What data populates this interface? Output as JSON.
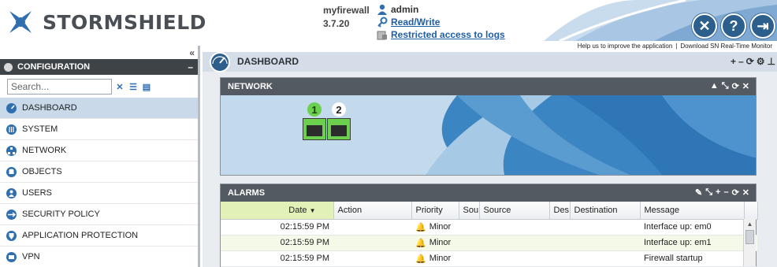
{
  "header": {
    "brand": "STORMSHIELD",
    "firewall_name": "myfirewall",
    "firmware_version": "3.7.20",
    "user": "admin",
    "access_mode": "Read/Write",
    "logs_access": "Restricted access to logs",
    "help_link": "Help us to improve the application",
    "monitor_link": "Download SN Real-Time Monitor",
    "separator": "|"
  },
  "sidebar": {
    "section_title": "CONFIGURATION",
    "search_placeholder": "Search...",
    "items": [
      {
        "label": "DASHBOARD",
        "icon": "gauge-icon",
        "active": true
      },
      {
        "label": "SYSTEM",
        "icon": "sliders-icon",
        "active": false
      },
      {
        "label": "NETWORK",
        "icon": "network-icon",
        "active": false
      },
      {
        "label": "OBJECTS",
        "icon": "database-icon",
        "active": false
      },
      {
        "label": "USERS",
        "icon": "user-icon",
        "active": false
      },
      {
        "label": "SECURITY POLICY",
        "icon": "arrows-icon",
        "active": false
      },
      {
        "label": "APPLICATION PROTECTION",
        "icon": "shield-icon",
        "active": false
      },
      {
        "label": "VPN",
        "icon": "vpn-icon",
        "active": false
      }
    ]
  },
  "main": {
    "title": "DASHBOARD",
    "network_panel": {
      "title": "NETWORK",
      "ports": [
        {
          "number": "1",
          "status": "active"
        },
        {
          "number": "2",
          "status": "connected"
        }
      ]
    },
    "alarms_panel": {
      "title": "ALARMS",
      "columns": [
        "Date",
        "Action",
        "Priority",
        "Sou",
        "Source",
        "Des",
        "Destination",
        "Message"
      ],
      "rows": [
        {
          "date": "02:15:59 PM",
          "action": "",
          "priority": "Minor",
          "sou": "",
          "source": "",
          "des": "",
          "destination": "",
          "message": "Interface up: em0"
        },
        {
          "date": "02:15:59 PM",
          "action": "",
          "priority": "Minor",
          "sou": "",
          "source": "",
          "des": "",
          "destination": "",
          "message": "Interface up: em1"
        },
        {
          "date": "02:15:59 PM",
          "action": "",
          "priority": "Minor",
          "sou": "",
          "source": "",
          "des": "",
          "destination": "",
          "message": "Firewall startup"
        }
      ]
    }
  },
  "colors": {
    "accent_blue": "#2d5f8d",
    "sidebar_active": "#c9d9ea",
    "panel_header": "#535a61",
    "port_green": "#6ad04e"
  }
}
